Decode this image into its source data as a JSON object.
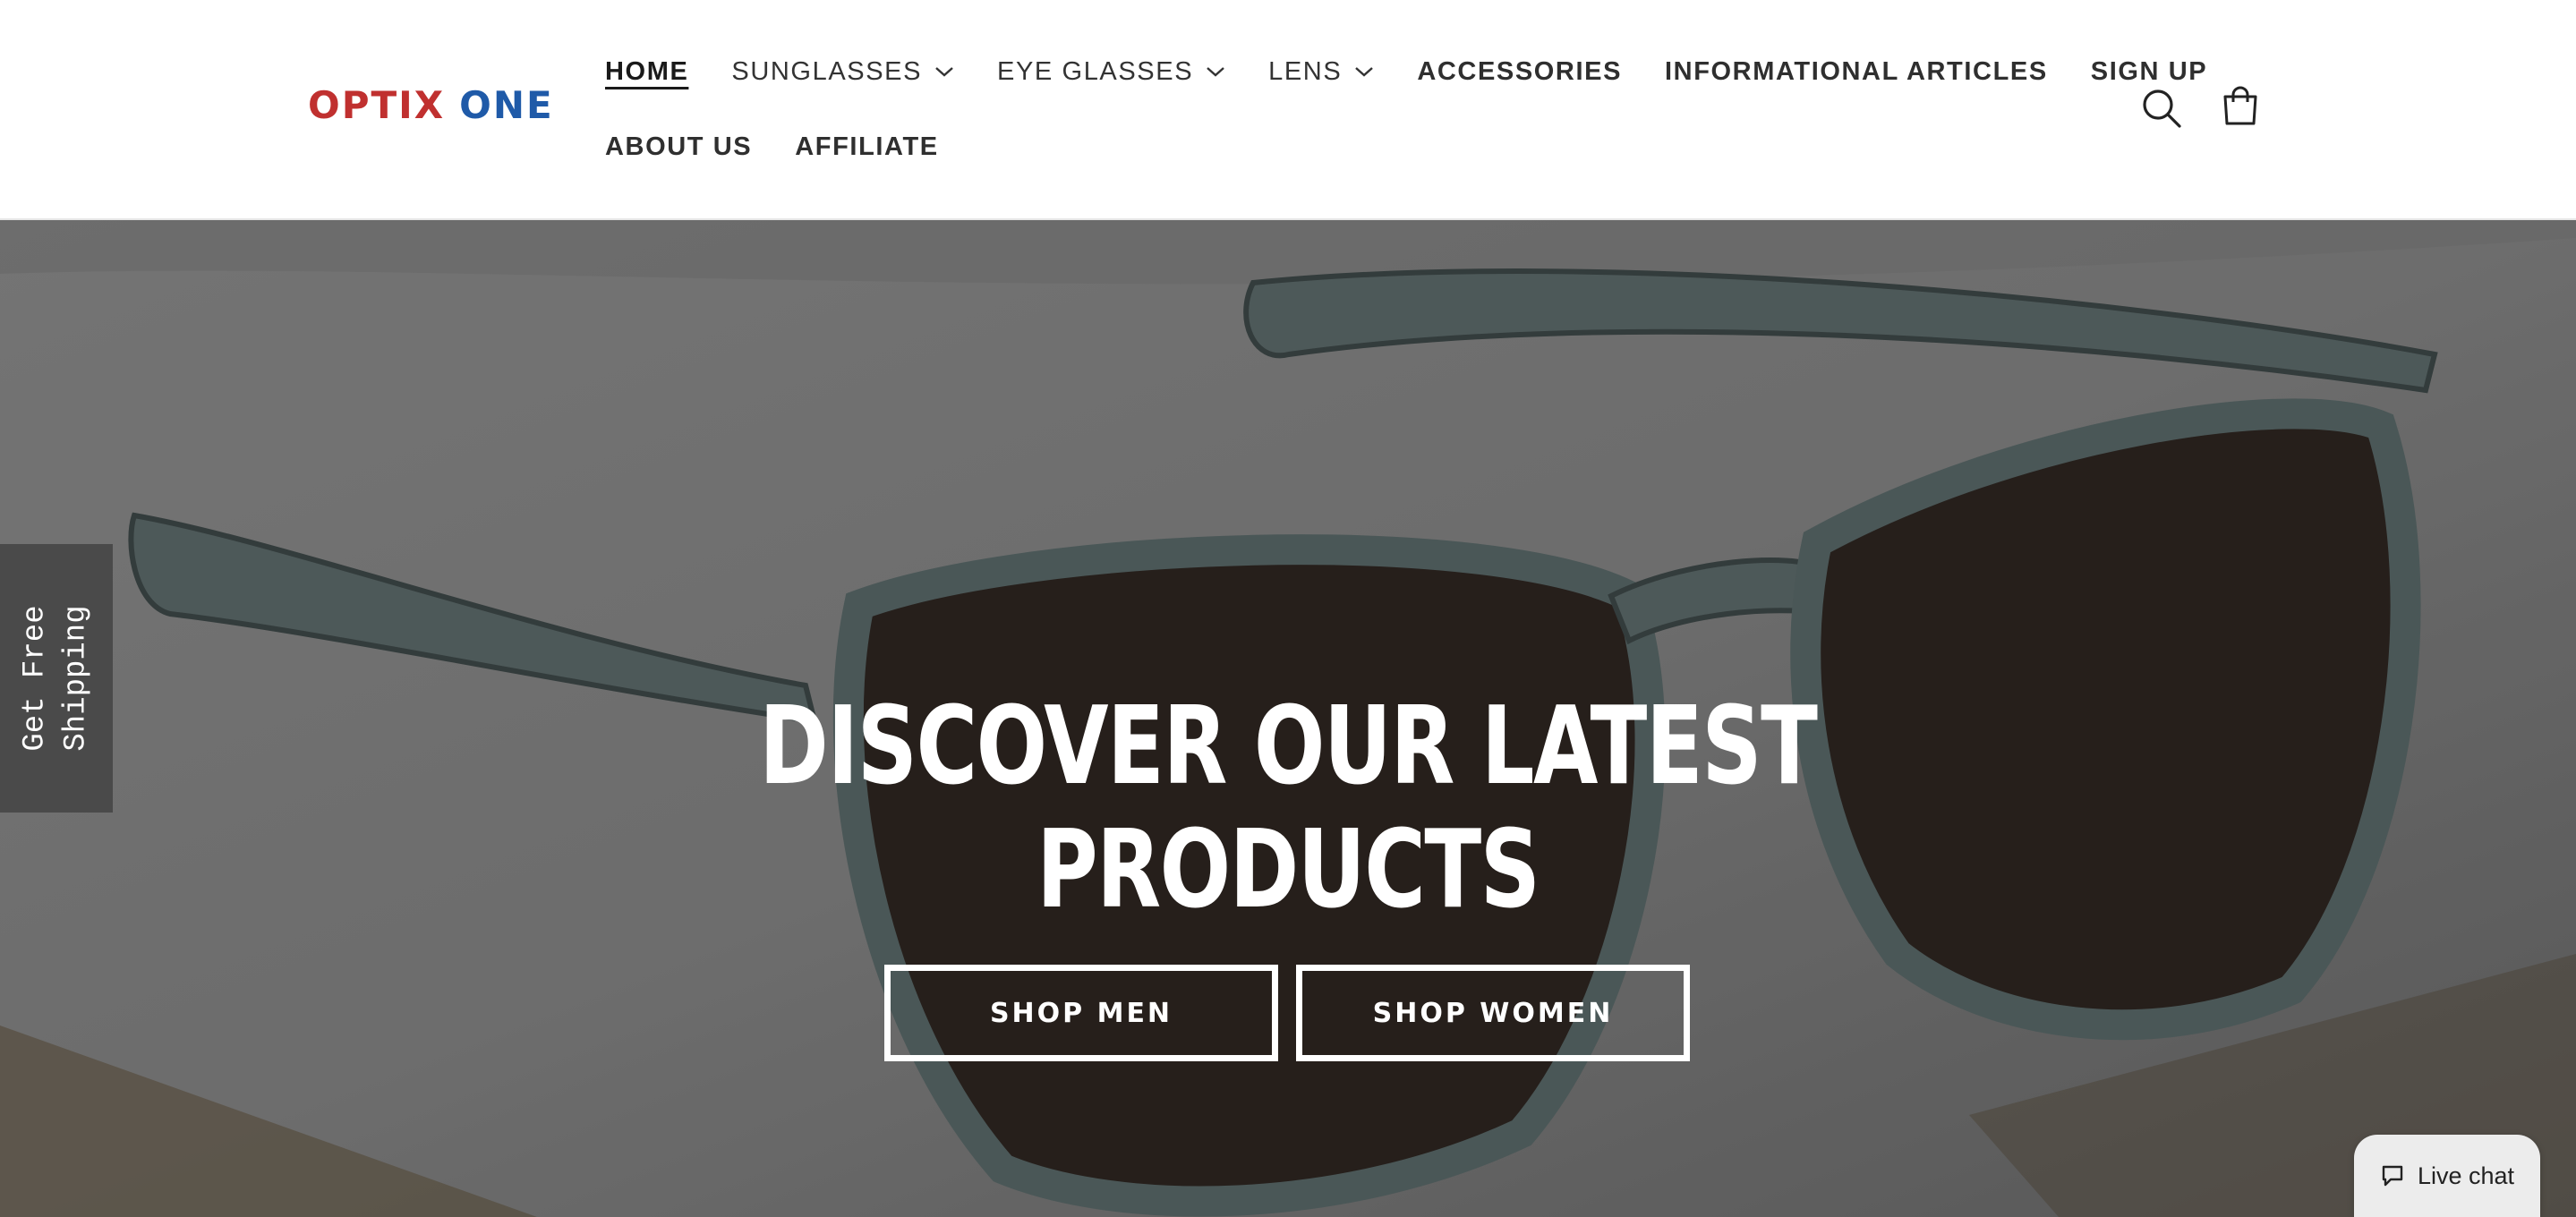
{
  "brand": {
    "logo_word1": "OPTIX",
    "logo_word2": "ONE"
  },
  "nav": {
    "row1": [
      {
        "label": "HOME",
        "active": true,
        "dropdown": false
      },
      {
        "label": "SUNGLASSES",
        "dropdown": true
      },
      {
        "label": "EYE GLASSES",
        "dropdown": true
      },
      {
        "label": "LENS",
        "dropdown": true
      },
      {
        "label": "ACCESSORIES",
        "dropdown": false
      },
      {
        "label": "INFORMATIONAL ARTICLES",
        "dropdown": false
      },
      {
        "label": "SIGN UP",
        "dropdown": false
      }
    ],
    "row2": [
      {
        "label": "ABOUT US",
        "dropdown": false
      },
      {
        "label": "AFFILIATE",
        "dropdown": false
      }
    ]
  },
  "header_icons": {
    "search": "search-icon",
    "cart": "cart-icon"
  },
  "hero": {
    "title_line1": "DISCOVER OUR LATEST",
    "title_line2": "PRODUCTS",
    "buttons": {
      "men": "SHOP MEN",
      "women": "SHOP WOMEN"
    }
  },
  "side_tab": {
    "line1": "Get Free",
    "line2": "Shipping"
  },
  "chat": {
    "label": "Live chat",
    "icon": "chat-bubble-icon"
  },
  "colors": {
    "brand_red": "#c0302f",
    "brand_blue": "#1f5aa8",
    "side_tab_bg": "#4a4a4a"
  }
}
